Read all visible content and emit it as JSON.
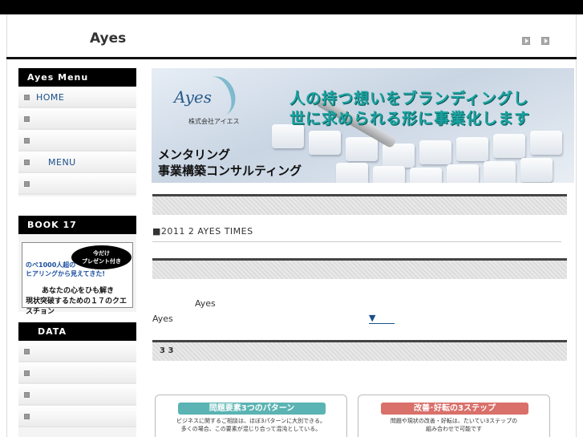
{
  "header": {
    "site_title": "Ayes",
    "prev_icon": "arrow-right-small-icon",
    "next_icon": "arrow-right-small-icon"
  },
  "sidebar": {
    "menu": {
      "title": "Ayes Menu",
      "items": [
        {
          "label": "HOME"
        },
        {
          "label": ""
        },
        {
          "label": ""
        },
        {
          "label": "MENU"
        },
        {
          "label": ""
        }
      ]
    },
    "book": {
      "title": "BOOK 17",
      "badge": "今だけ\nプレゼント付き",
      "line1": "のべ1000人超の",
      "line2": "ヒアリングから見えてきた!",
      "line3": "あなたの心をひも解き",
      "line4": "現状突破するための１７のクエスチョン"
    },
    "data": {
      "title": "DATA",
      "items": [
        {
          "label": ""
        },
        {
          "label": ""
        },
        {
          "label": ""
        },
        {
          "label": ""
        }
      ]
    }
  },
  "hero": {
    "logo": "Ayes",
    "company": "株式会社アイエス",
    "tagline1": "人の持つ想いをブランディングし",
    "tagline2": "世に求められる形に事業化します",
    "sub1": "メンタリング",
    "sub2": "事業構築コンサルティング"
  },
  "main": {
    "news": "■2011 2  AYES TIMES",
    "text_a": "Ayes",
    "text_b": "Ayes",
    "link": "▼",
    "bar3_text": "3           3",
    "card1": {
      "head": "問題要素3つのパターン",
      "line1": "ビジネスに関するご相談は、ほぼ3パターンに大別できる。",
      "line2": "多くの場合、この要素が混じり合って混沌としている。",
      "color": "#5bb3b3"
    },
    "card2": {
      "head": "改善･好転の3ステップ",
      "line1": "問題や現状の改善・好転は、たいてい3ステップの",
      "line2": "組み合わせで可能です",
      "color": "#d9706a"
    }
  }
}
